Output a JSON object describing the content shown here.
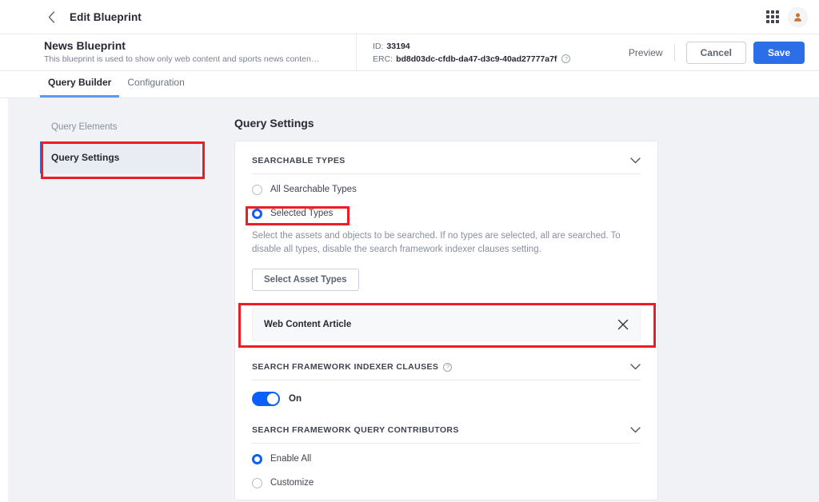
{
  "topbar": {
    "back_icon": "chevron-left-icon",
    "title": "Edit Blueprint",
    "apps_icon": "grid-apps-icon",
    "avatar_icon": "user-avatar-icon"
  },
  "blueprint_header": {
    "title": "News Blueprint",
    "description": "This blueprint is used to show only web content and sports news conten…",
    "id_label": "ID:",
    "id_value": "33194",
    "erc_label": "ERC:",
    "erc_value": "bd8d03dc-cfdb-da47-d3c9-40ad27777a7f",
    "erc_help_icon": "question-mark-icon",
    "preview_label": "Preview",
    "cancel_label": "Cancel",
    "save_label": "Save"
  },
  "tabs": [
    {
      "label": "Query Builder",
      "active": true
    },
    {
      "label": "Configuration",
      "active": false
    }
  ],
  "sidebar": {
    "group_label": "Query Elements",
    "items": [
      {
        "label": "Query Settings",
        "active": true
      }
    ]
  },
  "main": {
    "title": "Query Settings",
    "searchable_types": {
      "section_title": "SEARCHABLE TYPES",
      "chevron_icon": "chevron-down-icon",
      "options": [
        {
          "label": "All Searchable Types",
          "checked": false
        },
        {
          "label": "Selected Types",
          "checked": true
        }
      ],
      "help_text": "Select the assets and objects to be searched. If no types are selected, all are searched. To disable all types, disable the search framework indexer clauses setting.",
      "select_button_label": "Select Asset Types",
      "selected_items": [
        {
          "label": "Web Content Article",
          "remove_icon": "close-x-icon"
        }
      ]
    },
    "indexer_clauses": {
      "section_title": "SEARCH FRAMEWORK INDEXER CLAUSES",
      "help_icon": "question-mark-icon",
      "chevron_icon": "chevron-down-icon",
      "toggle_state_label": "On"
    },
    "query_contributors": {
      "section_title": "SEARCH FRAMEWORK QUERY CONTRIBUTORS",
      "chevron_icon": "chevron-down-icon",
      "options": [
        {
          "label": "Enable All",
          "checked": true
        },
        {
          "label": "Customize",
          "checked": false
        }
      ]
    }
  },
  "colors": {
    "primary_blue": "#2b6ee8",
    "radio_blue": "#0b5fff",
    "annotation_red": "#ee1c24",
    "avatar_orange": "#c87533",
    "page_bg": "#f1f2f5"
  }
}
